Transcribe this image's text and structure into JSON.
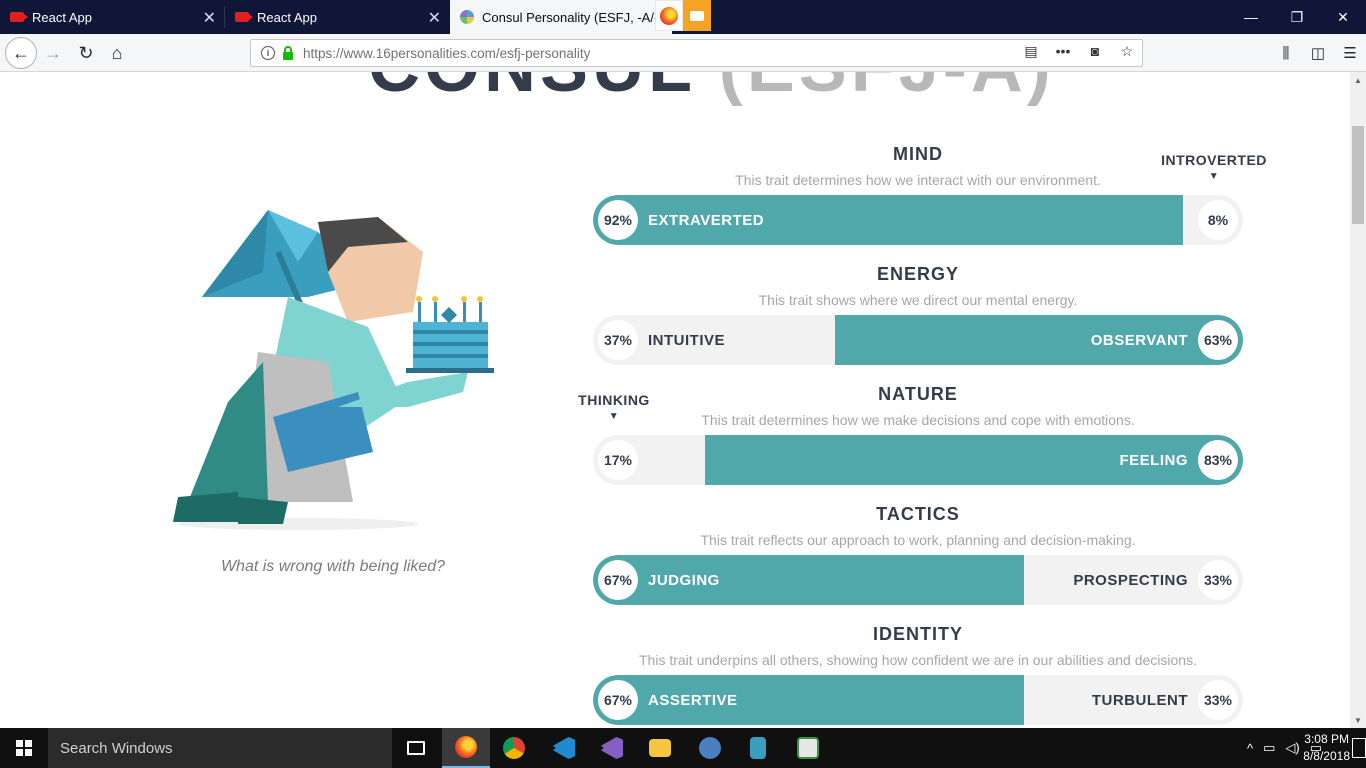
{
  "browser": {
    "tabs": [
      {
        "label": "React App"
      },
      {
        "label": "React App"
      },
      {
        "label": "Consul Personality (ESFJ, -A/-T"
      }
    ],
    "url": "https://www.16personalities.com/esfj-personality",
    "window_controls": {
      "minimize": "—",
      "restore": "❐",
      "close": "✕"
    }
  },
  "page": {
    "title_type": "CONSUL",
    "title_code": "(ESFJ-A)",
    "quote": "What is wrong with being liked?",
    "traits": [
      {
        "title": "MIND",
        "desc": "This trait determines how we interact with our environment.",
        "left_pct": "92%",
        "left_label": "EXTRAVERTED",
        "right_pct": "8%",
        "right_label": "",
        "fill_side": "left",
        "fill_fraction": 0.92,
        "side_label": "INTROVERTED"
      },
      {
        "title": "ENERGY",
        "desc": "This trait shows where we direct our mental energy.",
        "left_pct": "37%",
        "left_label": "INTUITIVE",
        "right_pct": "63%",
        "right_label": "OBSERVANT",
        "fill_side": "right",
        "fill_fraction": 0.63
      },
      {
        "title": "NATURE",
        "desc": "This trait determines how we make decisions and cope with emotions.",
        "left_pct": "17%",
        "left_label": "",
        "right_pct": "83%",
        "right_label": "FEELING",
        "fill_side": "right",
        "fill_fraction": 0.83,
        "side_label": "THINKING"
      },
      {
        "title": "TACTICS",
        "desc": "This trait reflects our approach to work, planning and decision-making.",
        "left_pct": "67%",
        "left_label": "JUDGING",
        "right_pct": "33%",
        "right_label": "PROSPECTING",
        "fill_side": "left",
        "fill_fraction": 0.67
      },
      {
        "title": "IDENTITY",
        "desc": "This trait underpins all others, showing how confident we are in our abilities and decisions.",
        "left_pct": "67%",
        "left_label": "ASSERTIVE",
        "right_pct": "33%",
        "right_label": "TURBULENT",
        "fill_side": "left",
        "fill_fraction": 0.67
      }
    ],
    "colors": {
      "fill": "#51a8ab",
      "track": "#f2f2f2",
      "heading": "#343c4b"
    }
  },
  "taskbar": {
    "search_placeholder": "Search Windows",
    "time": "3:08 PM",
    "date": "8/8/2018"
  }
}
